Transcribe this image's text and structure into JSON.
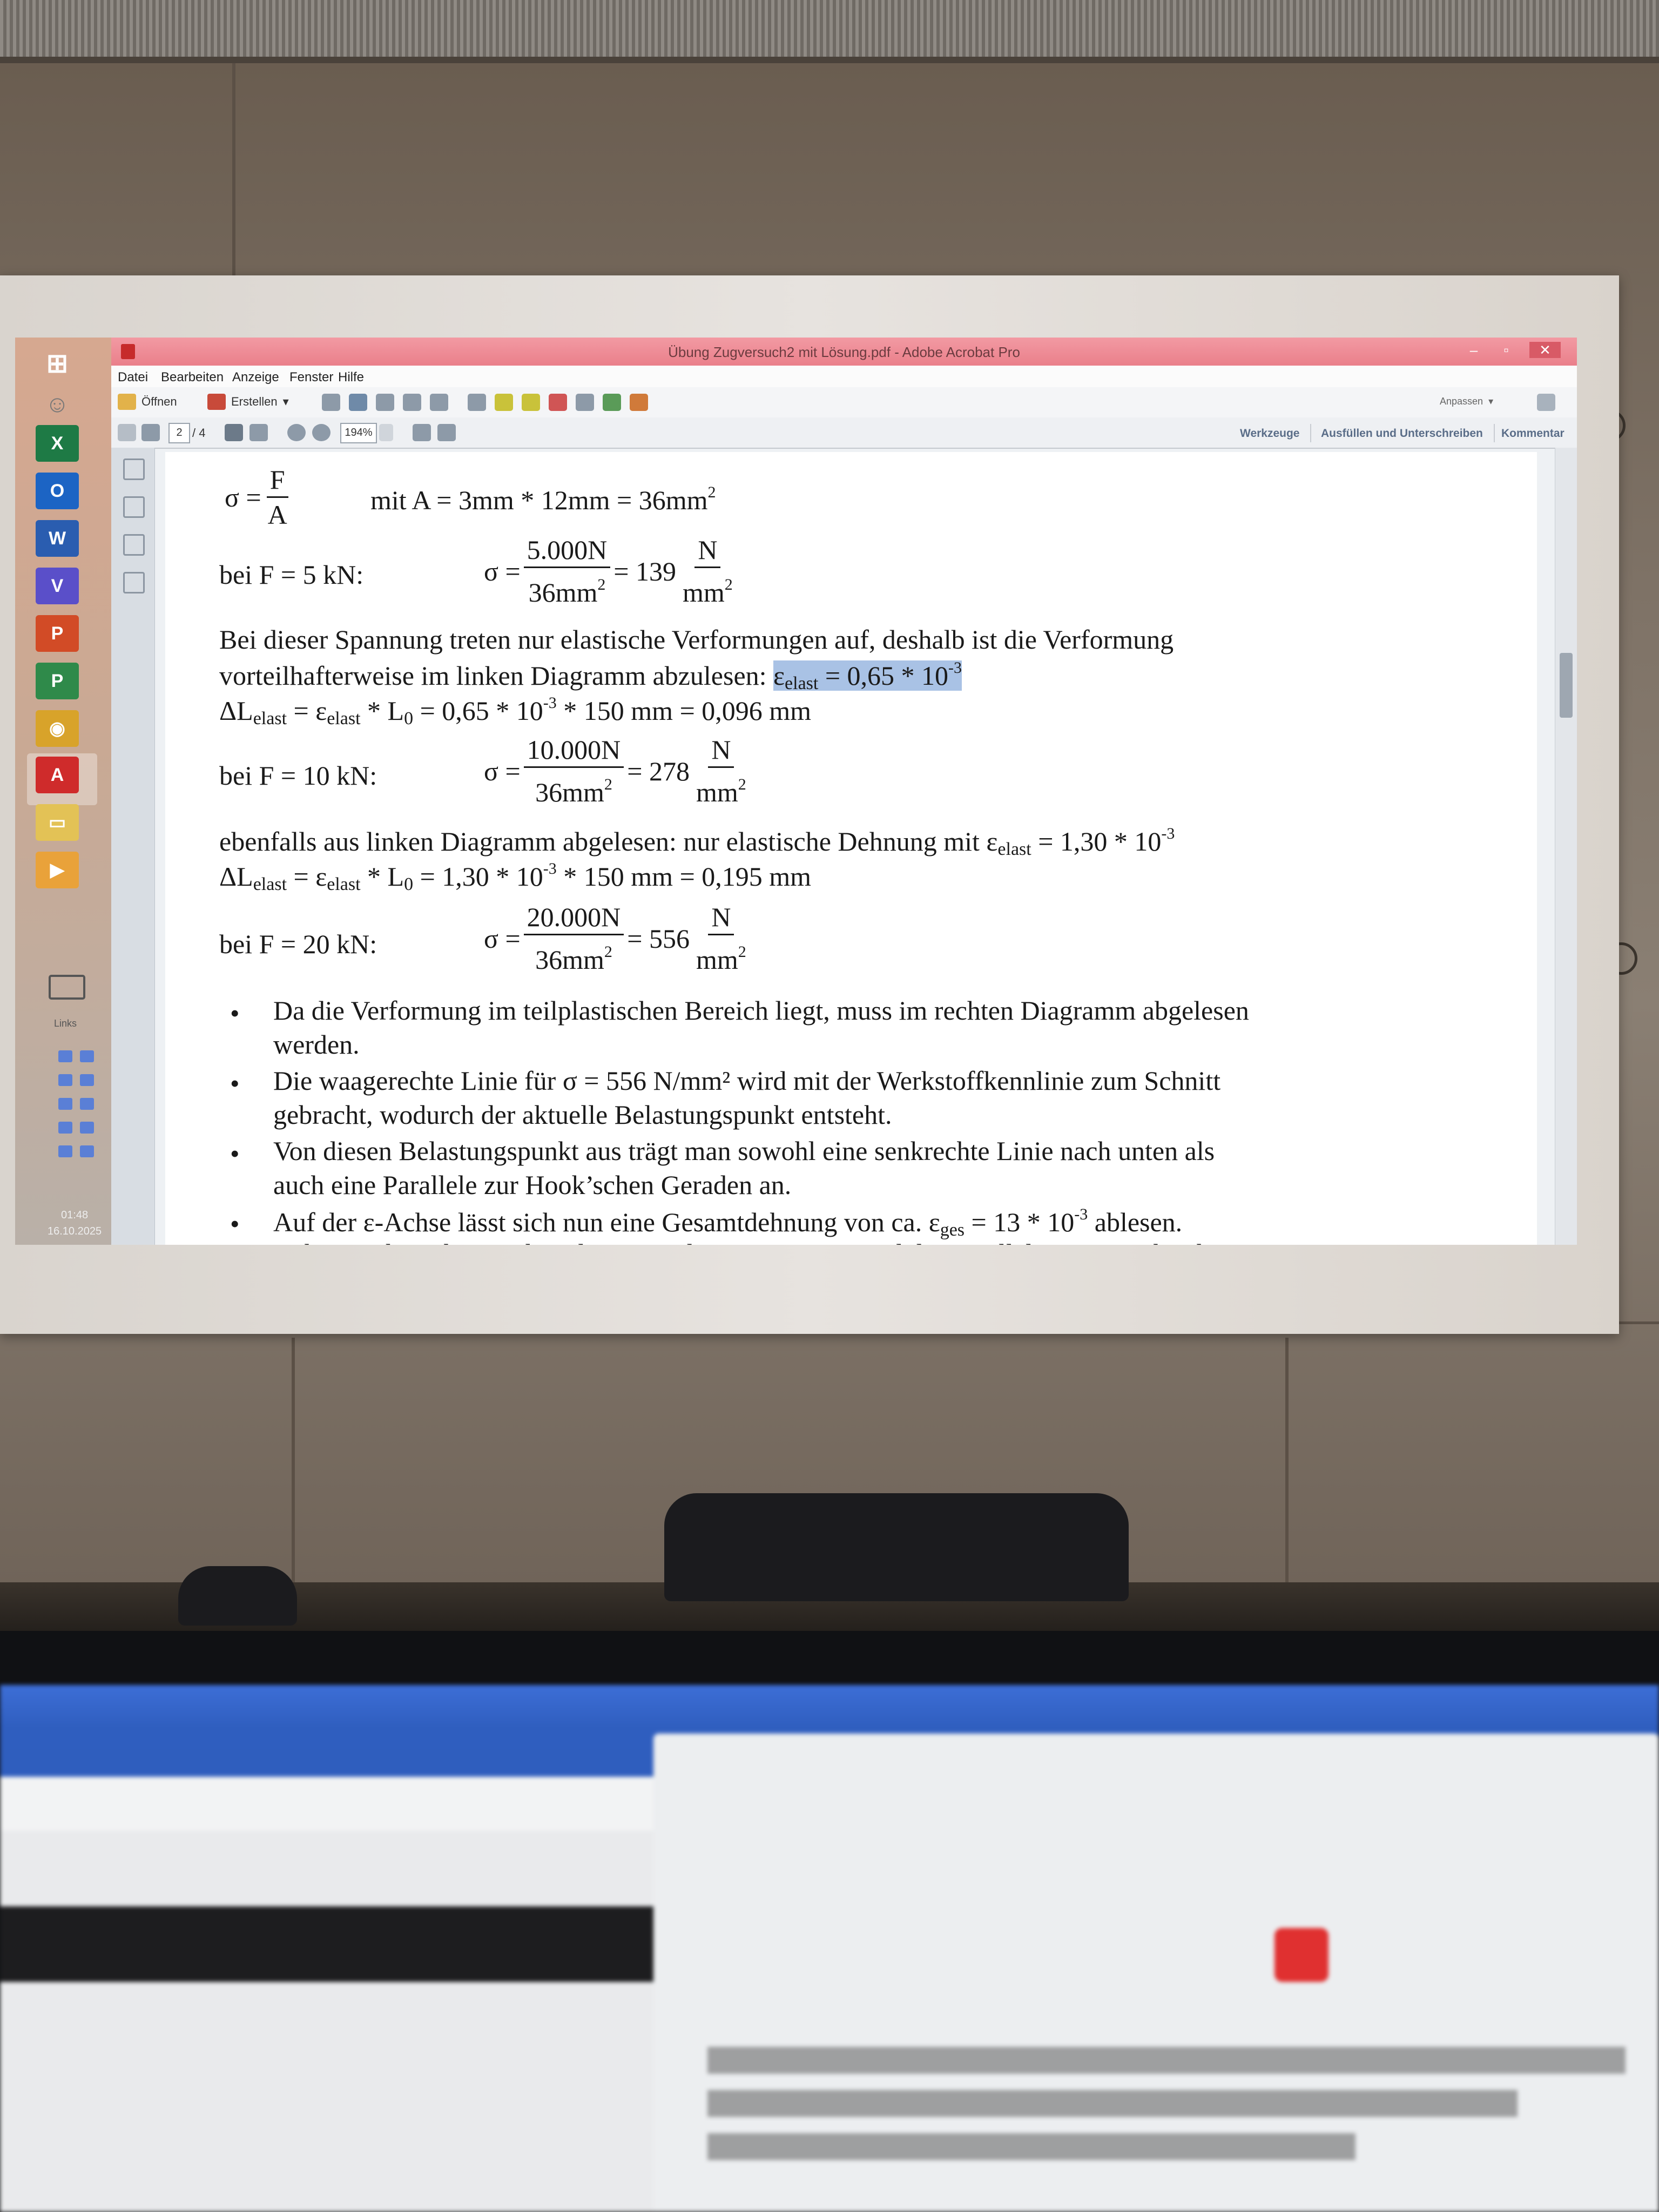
{
  "window": {
    "title": "Übung Zugversuch2 mit Lösung.pdf - Adobe Acrobat Pro",
    "minimize": "–",
    "maximize": "▫",
    "close": "✕"
  },
  "menu": [
    "Datei",
    "Bearbeiten",
    "Anzeige",
    "Fenster",
    "Hilfe"
  ],
  "toolbar": {
    "open_label": "Öffnen",
    "create_label": "Erstellen",
    "customize_label": "Anpassen",
    "page_current": "2",
    "page_total": "/ 4",
    "zoom": "194%"
  },
  "right_panels": [
    "Werkzeuge",
    "Ausfüllen und Unterschreiben",
    "Kommentar"
  ],
  "taskbar": {
    "links_label": "Links",
    "time": "01:48",
    "date": "16.10.2025",
    "apps": [
      {
        "name": "excel",
        "glyph": "X",
        "color": "#1e7a45"
      },
      {
        "name": "outlook",
        "glyph": "O",
        "color": "#1c64c4"
      },
      {
        "name": "word",
        "glyph": "W",
        "color": "#2a5db0"
      },
      {
        "name": "visio",
        "glyph": "V",
        "color": "#5a4fc9"
      },
      {
        "name": "powerpoint",
        "glyph": "P",
        "color": "#d24b26"
      },
      {
        "name": "project",
        "glyph": "P",
        "color": "#2f8a4a"
      },
      {
        "name": "chrome",
        "glyph": "◉",
        "color": "#d8a32a"
      },
      {
        "name": "acrobat",
        "glyph": "A",
        "color": "#cf2b2b"
      },
      {
        "name": "explorer",
        "glyph": "▭",
        "color": "#e3c256"
      },
      {
        "name": "media",
        "glyph": "▶",
        "color": "#e9a23a"
      }
    ]
  },
  "document": {
    "formula": {
      "lhs": "σ =",
      "num": "F",
      "den": "A",
      "area_text": "mit A = 3mm * 12mm = 36mm",
      "area_sup": "2"
    },
    "case1": {
      "label": "bei F = 5 kN:",
      "sigma": "σ =",
      "num": "5.000N",
      "den": "36mm",
      "den_sup": "2",
      "result": "= 139",
      "unit_num": "N",
      "unit_den": "mm",
      "unit_sup": "2"
    },
    "para1_line1": "Bei dieser Spannung treten nur elastische Verformungen auf, deshalb ist die Verformung",
    "para1_line2_a": "vorteilhafterweise im linken Diagramm abzulesen: ",
    "eps": "ε",
    "elast": "elast",
    "para1_hl": " = 0,65 * 10",
    "exp_neg3": "-3",
    "dL1_a": "ΔL",
    "dL1_b": " = ε",
    "dL1_c": " * L",
    "L0_sub": "0",
    "dL1_d": " = 0,65 * 10",
    "dL1_e": " * 150 mm = 0,096 mm",
    "case2": {
      "label": "bei F = 10 kN:",
      "sigma": "σ =",
      "num": "10.000N",
      "den": "36mm",
      "den_sup": "2",
      "result": "= 278",
      "unit_num": "N",
      "unit_den": "mm",
      "unit_sup": "2"
    },
    "para2_a": "ebenfalls aus linken Diagramm abgelesen: nur elastische Dehnung mit ε",
    "para2_b": " = 1,30 * 10",
    "dL2_d": " = 1,30 * 10",
    "dL2_e": " * 150 mm = 0,195 mm",
    "case3": {
      "label": "bei F = 20 kN:",
      "sigma": "σ =",
      "num": "20.000N",
      "den": "36mm",
      "den_sup": "2",
      "result": "= 556",
      "unit_num": "N",
      "unit_den": "mm",
      "unit_sup": "2"
    },
    "bullet_char": "•",
    "b1_l1": "Da die Verformung im teilplastischen Bereich liegt, muss im rechten Diagramm abgelesen",
    "b1_l2": "werden.",
    "b2_l1": "Die waagerechte Linie für σ = 556 N/mm² wird mit der Werkstoffkennlinie zum Schnitt",
    "b2_l2": "gebracht, wodurch der aktuelle Belastungspunkt entsteht.",
    "b3_l1": "Von diesen Belastungspunkt aus trägt man sowohl eine senkrechte Linie nach unten als",
    "b3_l2": "auch eine Parallele zur Hook’schen Geraden an.",
    "b4_l1_a": "Auf der ε-Achse lässt sich nun eine Gesamtdehnung von ca. ε",
    "ges": "ges",
    "b4_l1_b": " = 13 * 10",
    "b4_l1_c": " ablesen.",
    "b4_l2": "Dabei ergibt sich zwischen dem Koordinatenursprung und der Parallelen zur Hook’schen"
  }
}
